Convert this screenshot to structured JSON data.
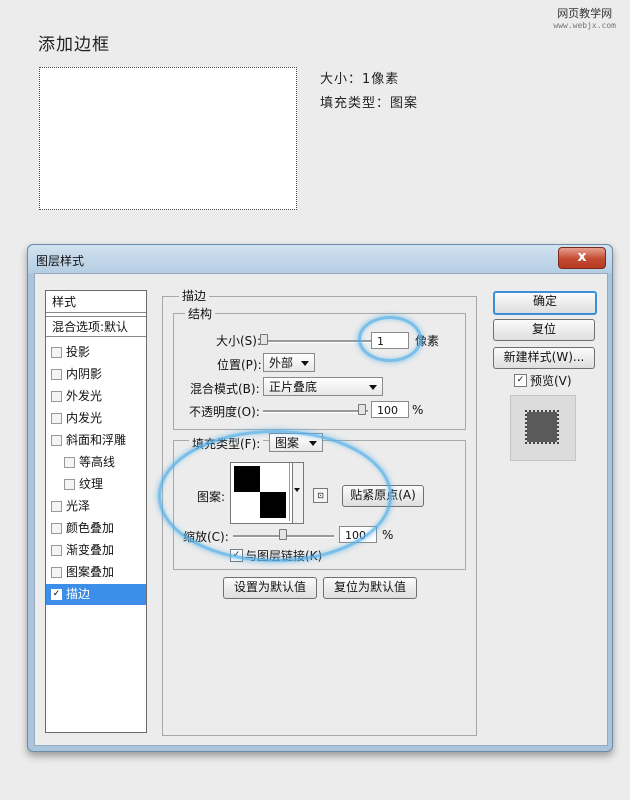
{
  "page": {
    "title": "添加边框",
    "watermark": [
      "网页教学网",
      "www.webjx.com"
    ],
    "info": [
      "大小：1像素",
      "填充类型：图案"
    ]
  },
  "dialog": {
    "title": "图层样式",
    "close_glyph": "x",
    "styles_header": "样式",
    "blend_options": "混合选项:默认",
    "styles": [
      {
        "label": "投影",
        "checked": false
      },
      {
        "label": "内阴影",
        "checked": false
      },
      {
        "label": "外发光",
        "checked": false
      },
      {
        "label": "内发光",
        "checked": false
      },
      {
        "label": "斜面和浮雕",
        "checked": false
      },
      {
        "label": "等高线",
        "checked": false
      },
      {
        "label": "纹理",
        "checked": false
      },
      {
        "label": "光泽",
        "checked": false
      },
      {
        "label": "颜色叠加",
        "checked": false
      },
      {
        "label": "渐变叠加",
        "checked": false
      },
      {
        "label": "图案叠加",
        "checked": false
      },
      {
        "label": "描边",
        "checked": true
      }
    ],
    "stroke": {
      "group_title": "描边",
      "structure_title": "结构",
      "size_label": "大小(S):",
      "size_value": "1",
      "size_unit": "像素",
      "position_label": "位置(P):",
      "position_value": "外部",
      "blend_label": "混合模式(B):",
      "blend_value": "正片叠底",
      "opacity_label": "不透明度(O):",
      "opacity_value": "100",
      "opacity_unit": "%",
      "fill_type_label": "填充类型(F):",
      "fill_type_value": "图案",
      "pattern_label": "图案:",
      "snap_origin_label": "贴紧原点(A)",
      "scale_label": "缩放(C):",
      "scale_value": "100",
      "scale_unit": "%",
      "link_label": "与图层链接(K)",
      "link_checked": true
    },
    "set_default_label": "设置为默认值",
    "reset_default_label": "复位为默认值",
    "ok_label": "确定",
    "reset_label": "复位",
    "new_style_label": "新建样式(W)...",
    "preview_label": "预览(V)",
    "preview_checked": true,
    "accent_color": "#3d8ee8",
    "highlight_color": "#54b0e8"
  }
}
